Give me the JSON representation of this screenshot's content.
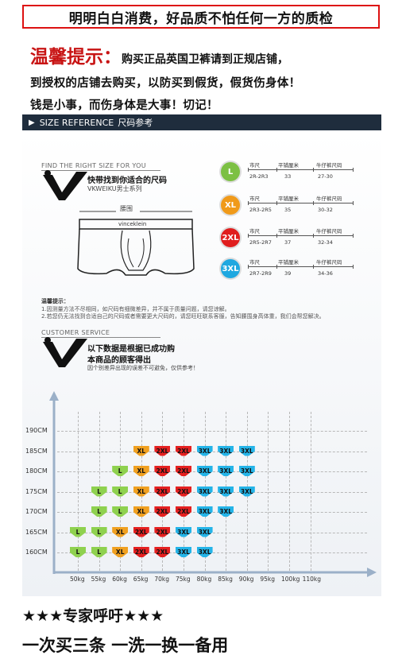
{
  "banner": "明明白白消费，好品质不怕任何一方的质检",
  "notice": {
    "title": "温馨提示：",
    "line1": "购买正品英国卫裤请到正规店铺，",
    "line2": "到授权的店铺去购买，以防买到假货，假货伤身体！",
    "line3": "钱是小事，而伤身体是大事！切记！"
  },
  "size_ref": {
    "label": "SIZE REFERENCE",
    "label_cn": "尺码参考"
  },
  "find_size": {
    "en": "FIND THE RIGHT SIZE FOR YOU",
    "cn": "快带找到你适合的尺码",
    "brand_line": "VKWEIKU男士系列",
    "waist": "腰围",
    "waistband": "vinceklein"
  },
  "size_table": {
    "headers": [
      "市尺",
      "平铺厘米",
      "牛仔裤尺码"
    ],
    "rows": [
      {
        "size": "L",
        "color": "#7cc043",
        "shi": "2R-2R3",
        "cm": "33",
        "jeans": "27-30"
      },
      {
        "size": "XL",
        "color": "#f09a1a",
        "shi": "2R3-2R5",
        "cm": "35",
        "jeans": "30-32"
      },
      {
        "size": "2XL",
        "color": "#e01e1e",
        "shi": "2R5-2R7",
        "cm": "37",
        "jeans": "32-34"
      },
      {
        "size": "3XL",
        "color": "#1fa8e0",
        "shi": "2R7-2R9",
        "cm": "39",
        "jeans": "34-36"
      }
    ]
  },
  "tips": {
    "title": "温馨提示：",
    "line1": "1.因测量方法不尽相同，如尺码有细微差异，并不属于质量问题，请您谅解。",
    "line2": "2.若您仍无法找到合适自己的尺码或者需要更大尺码的，请您旺旺联系客服，告知腰围身高体重，我们会帮您解决。"
  },
  "customer_service": {
    "en": "CUSTOMER SERVICE",
    "line1": "以下数据是根据已成功购",
    "line2": "本商品的顾客得出",
    "line3": "因个别差异出现的误差不可避免，仅供参考！"
  },
  "chart_data": {
    "type": "table",
    "y_labels": [
      "190CM",
      "185CM",
      "180CM",
      "175CM",
      "170CM",
      "165CM",
      "160CM"
    ],
    "x_labels": [
      "50kg",
      "55kg",
      "60kg",
      "65kg",
      "70kg",
      "75kg",
      "80kg",
      "85kg",
      "90kg",
      "95kg",
      "100kg",
      "110kg"
    ],
    "rows": [
      {
        "height": "185CM",
        "sizes": [
          "",
          "",
          "",
          "XL",
          "2XL",
          "2XL",
          "3XL",
          "3XL",
          "3XL"
        ]
      },
      {
        "height": "180CM",
        "sizes": [
          "",
          "",
          "L",
          "XL",
          "2XL",
          "2XL",
          "3XL",
          "3XL",
          "3XL"
        ]
      },
      {
        "height": "175CM",
        "sizes": [
          "",
          "L",
          "L",
          "XL",
          "2XL",
          "2XL",
          "3XL",
          "3XL",
          "3XL"
        ]
      },
      {
        "height": "170CM",
        "sizes": [
          "",
          "L",
          "L",
          "XL",
          "2XL",
          "2XL",
          "3XL",
          "3XL",
          ""
        ]
      },
      {
        "height": "165CM",
        "sizes": [
          "L",
          "L",
          "XL",
          "2XL",
          "2XL",
          "3XL",
          "3XL",
          "",
          ""
        ]
      },
      {
        "height": "160CM",
        "sizes": [
          "L",
          "L",
          "XL",
          "2XL",
          "2XL",
          "3XL",
          "3XL",
          "",
          ""
        ]
      }
    ]
  },
  "bottom": {
    "line1": "★★★专家呼吁★★★",
    "line2": "一次买三条 一洗一换一备用"
  }
}
